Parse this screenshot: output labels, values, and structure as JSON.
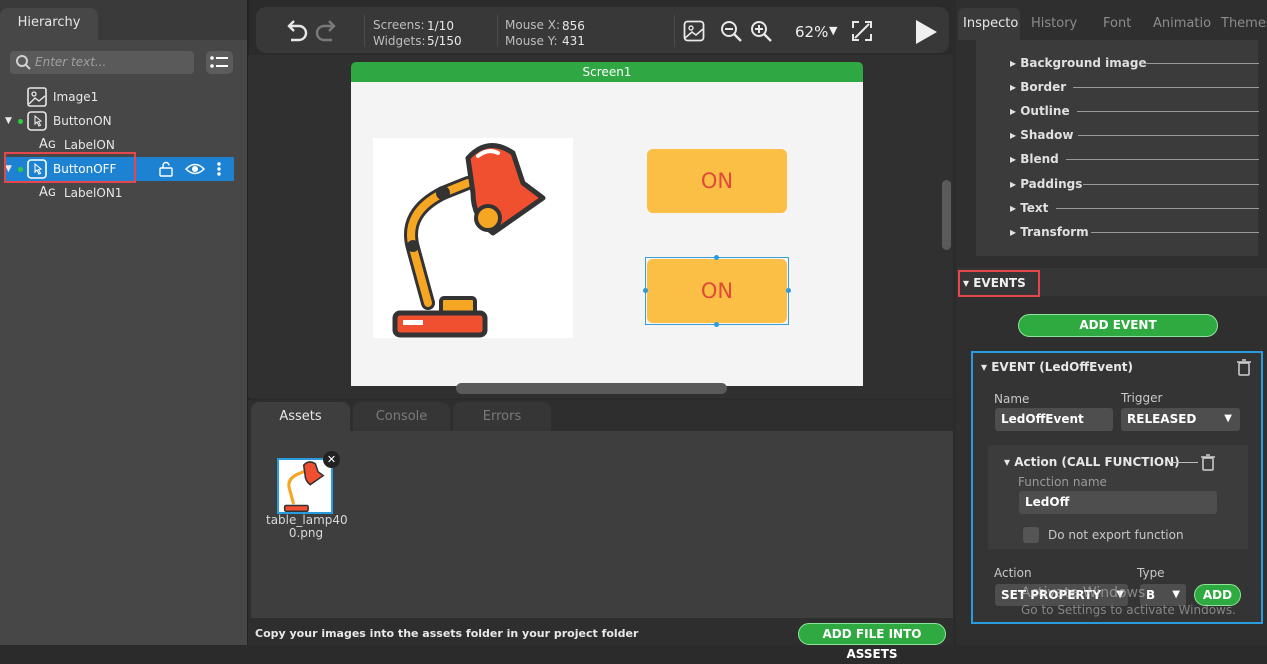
{
  "hierarchy": {
    "tab": "Hierarchy",
    "search_placeholder": "Enter text...",
    "nodes": [
      {
        "label": "Image1"
      },
      {
        "label": "ButtonON"
      },
      {
        "label": "LabelON"
      },
      {
        "label": "ButtonOFF"
      },
      {
        "label": "LabelON1"
      }
    ]
  },
  "toolbar": {
    "screens_label": "Screens:",
    "screens_value": "1/10",
    "widgets_label": "Widgets:",
    "widgets_value": "5/150",
    "mousex_label": "Mouse X:",
    "mousex_value": "856",
    "mousey_label": "Mouse Y:",
    "mousey_value": "431",
    "zoom": "62%"
  },
  "canvas": {
    "screen_title": "Screen1",
    "button_top_label": "ON",
    "button_bottom_label": "ON"
  },
  "bottom": {
    "tabs": [
      "Assets",
      "Console",
      "Errors"
    ],
    "asset_name_line1": "table_lamp40",
    "asset_name_line2": "0.png",
    "hint": "Copy your images into the assets folder in your project folder",
    "add_file_button": "ADD FILE INTO ASSETS"
  },
  "inspector": {
    "tabs": [
      "Inspecto",
      "History",
      "Font",
      "Animatio",
      "Themes"
    ],
    "properties": [
      "Background image",
      "Border",
      "Outline",
      "Shadow",
      "Blend",
      "Paddings",
      "Text",
      "Transform"
    ],
    "events_header": "EVENTS",
    "add_event_button": "ADD EVENT",
    "event_title": "EVENT (LedOffEvent)",
    "name_label": "Name",
    "name_value": "LedOffEvent",
    "trigger_label": "Trigger",
    "trigger_value": "RELEASED",
    "action_title": "Action (CALL FUNCTION)",
    "function_name_label": "Function name",
    "function_name_value": "LedOff",
    "do_not_export_label": "Do not export function",
    "action_label": "Action",
    "action_value": "SET PROPERTY",
    "type_label": "Type",
    "type_value": "B",
    "add_button": "ADD",
    "watermark_line1": "Activate Windows",
    "watermark_line2": "Go to Settings to activate Windows."
  },
  "colors": {
    "accent_green": "#2eaa40",
    "selection_blue": "#1e82d2",
    "highlight_red": "#e5474e",
    "button_yellow": "#fbbf45",
    "button_text": "#e04a38"
  }
}
